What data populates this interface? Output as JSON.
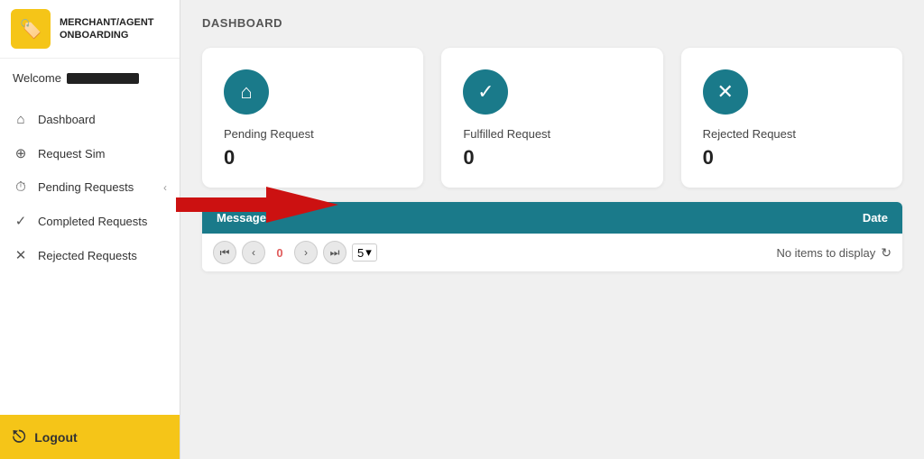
{
  "sidebar": {
    "logo_emoji": "🏷️",
    "title_line1": "MERCHANT/AGENT",
    "title_line2": "ONBOARDING",
    "welcome_label": "Welcome",
    "nav_items": [
      {
        "id": "dashboard",
        "label": "Dashboard",
        "icon": "⌂"
      },
      {
        "id": "request-sim",
        "label": "Request Sim",
        "icon": "⊕"
      },
      {
        "id": "pending-requests",
        "label": "Pending Requests",
        "icon": "⏱",
        "has_chevron": true
      },
      {
        "id": "completed-requests",
        "label": "Completed Requests",
        "icon": "✓"
      },
      {
        "id": "rejected-requests",
        "label": "Rejected Requests",
        "icon": "✕"
      }
    ],
    "logout_label": "Logout",
    "logout_icon": "⎋"
  },
  "main": {
    "page_title": "DASHBOARD",
    "cards": [
      {
        "id": "pending",
        "icon": "⌂",
        "label": "Pending Request",
        "value": "0"
      },
      {
        "id": "fulfilled",
        "icon": "✓",
        "label": "Fulfilled Request",
        "value": "0"
      },
      {
        "id": "rejected",
        "icon": "✕",
        "label": "Rejected Request",
        "value": "0"
      }
    ],
    "table": {
      "col_message": "Message",
      "col_date": "Date",
      "pagination": {
        "current_page": "0",
        "page_size": "5",
        "no_items_text": "No items to display"
      }
    }
  },
  "colors": {
    "teal": "#1a7a8a",
    "yellow": "#f5c518",
    "red_arrow": "#cc1111"
  }
}
